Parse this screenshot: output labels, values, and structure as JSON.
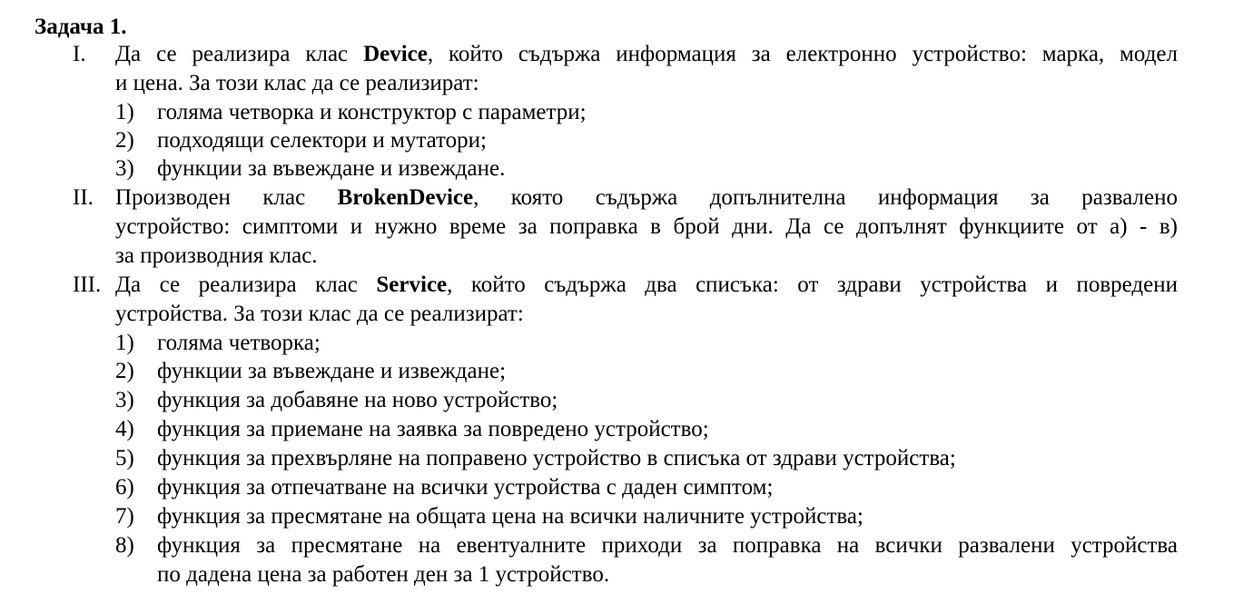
{
  "title": "Задача 1.",
  "sections": [
    {
      "numeral": "I.",
      "line1_a": "Да се реализира клас ",
      "line1_bold": "Device",
      "line1_b": ", който съдържа информация за електронно устройство: марка, модел",
      "line2": "и цена. За този клас да се реализират:",
      "items": [
        {
          "num": "1)",
          "text": "голяма четворка и конструктор с параметри;"
        },
        {
          "num": "2)",
          "text": "подходящи селектори и мутатори;"
        },
        {
          "num": "3)",
          "text": "функции за въвеждане и извеждане."
        }
      ]
    },
    {
      "numeral": "II.",
      "line1_a": "Производен клас ",
      "line1_bold": "BrokenDevice",
      "line1_b": ", която съдържа допълнителна информация за развалено",
      "line2": "устройство: симптоми и нужно време за поправка в брой дни. Да се допълнят функциите от а) - в)",
      "line3": "за производния клас."
    },
    {
      "numeral": "III.",
      "line1_a": "Да се реализира клас ",
      "line1_bold": "Service",
      "line1_b": ", който съдържа два списъка: от здрави устройства и повредени",
      "line2": "устройства. За този клас да се реализират:",
      "items": [
        {
          "num": "1)",
          "text": "голяма четворка;"
        },
        {
          "num": "2)",
          "text": "функции за въвеждане и извеждане;"
        },
        {
          "num": "3)",
          "text": "функция за добавяне на ново устройство;"
        },
        {
          "num": "4)",
          "text": "функция за приемане на заявка за повредено устройство;"
        },
        {
          "num": "5)",
          "text": "функция за прехвърляне на поправено устройство в списъка от здрави устройства;"
        },
        {
          "num": "6)",
          "text": "функция за отпечатване на всички устройства с даден симптом;"
        },
        {
          "num": "7)",
          "text": "функция за пресмятане на общата цена на всички наличните устройства;"
        },
        {
          "num": "8)",
          "text_line1": "функция за пресмятане на евентуалните приходи за поправка на всички развалени устройства",
          "text_line2": "по дадена цена за работен ден за 1 устройство."
        }
      ]
    }
  ]
}
